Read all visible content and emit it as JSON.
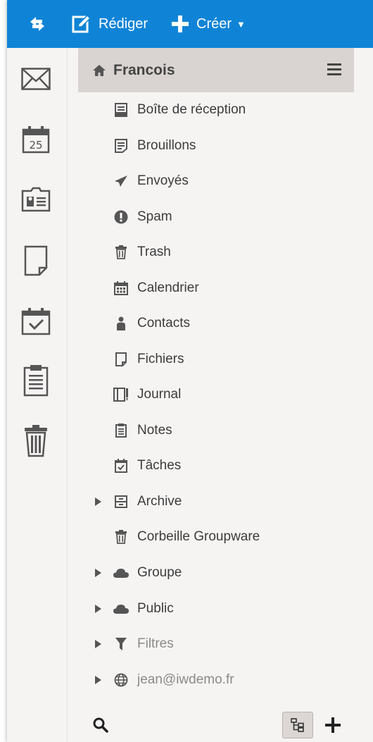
{
  "toolbar": {
    "sync_icon": "sync-icon",
    "compose_label": "Rédiger",
    "create_label": "Créer",
    "accent_color": "#0f84d6"
  },
  "rail": {
    "items": [
      {
        "name": "mail",
        "icon": "mail-icon"
      },
      {
        "name": "calendar",
        "icon": "calendar-icon",
        "badge": "25"
      },
      {
        "name": "contacts",
        "icon": "contact-card-icon"
      },
      {
        "name": "files",
        "icon": "file-icon"
      },
      {
        "name": "tasks",
        "icon": "task-icon"
      },
      {
        "name": "journal",
        "icon": "clipboard-icon"
      },
      {
        "name": "trash",
        "icon": "trash-icon"
      }
    ]
  },
  "account": {
    "name": "Francois",
    "menu_icon": "hamburger-icon"
  },
  "folders": [
    {
      "label": "Boîte de réception",
      "icon": "inbox-icon"
    },
    {
      "label": "Brouillons",
      "icon": "drafts-icon"
    },
    {
      "label": "Envoyés",
      "icon": "paper-plane-icon"
    },
    {
      "label": "Spam",
      "icon": "exclamation-icon"
    },
    {
      "label": "Trash",
      "icon": "trash-icon"
    },
    {
      "label": "Calendrier",
      "icon": "calendar-icon"
    },
    {
      "label": "Contacts",
      "icon": "person-icon"
    },
    {
      "label": "Fichiers",
      "icon": "file-icon"
    },
    {
      "label": "Journal",
      "icon": "journal-icon"
    },
    {
      "label": "Notes",
      "icon": "notes-icon"
    },
    {
      "label": "Tâches",
      "icon": "task-icon"
    },
    {
      "label": "Archive",
      "icon": "archive-icon",
      "expandable": true
    },
    {
      "label": "Corbeille Groupware",
      "icon": "trash-icon"
    },
    {
      "label": "Groupe",
      "icon": "cloud-icon",
      "expandable": true
    },
    {
      "label": "Public",
      "icon": "cloud-icon",
      "expandable": true
    },
    {
      "label": "Filtres",
      "icon": "filter-icon",
      "expandable": true,
      "muted": true
    },
    {
      "label": "jean@iwdemo.fr",
      "icon": "globe-icon",
      "expandable": true,
      "muted": true
    }
  ],
  "bottom": {
    "search_icon": "search-icon",
    "tree_icon": "tree-view-icon",
    "add_icon": "plus-icon"
  }
}
